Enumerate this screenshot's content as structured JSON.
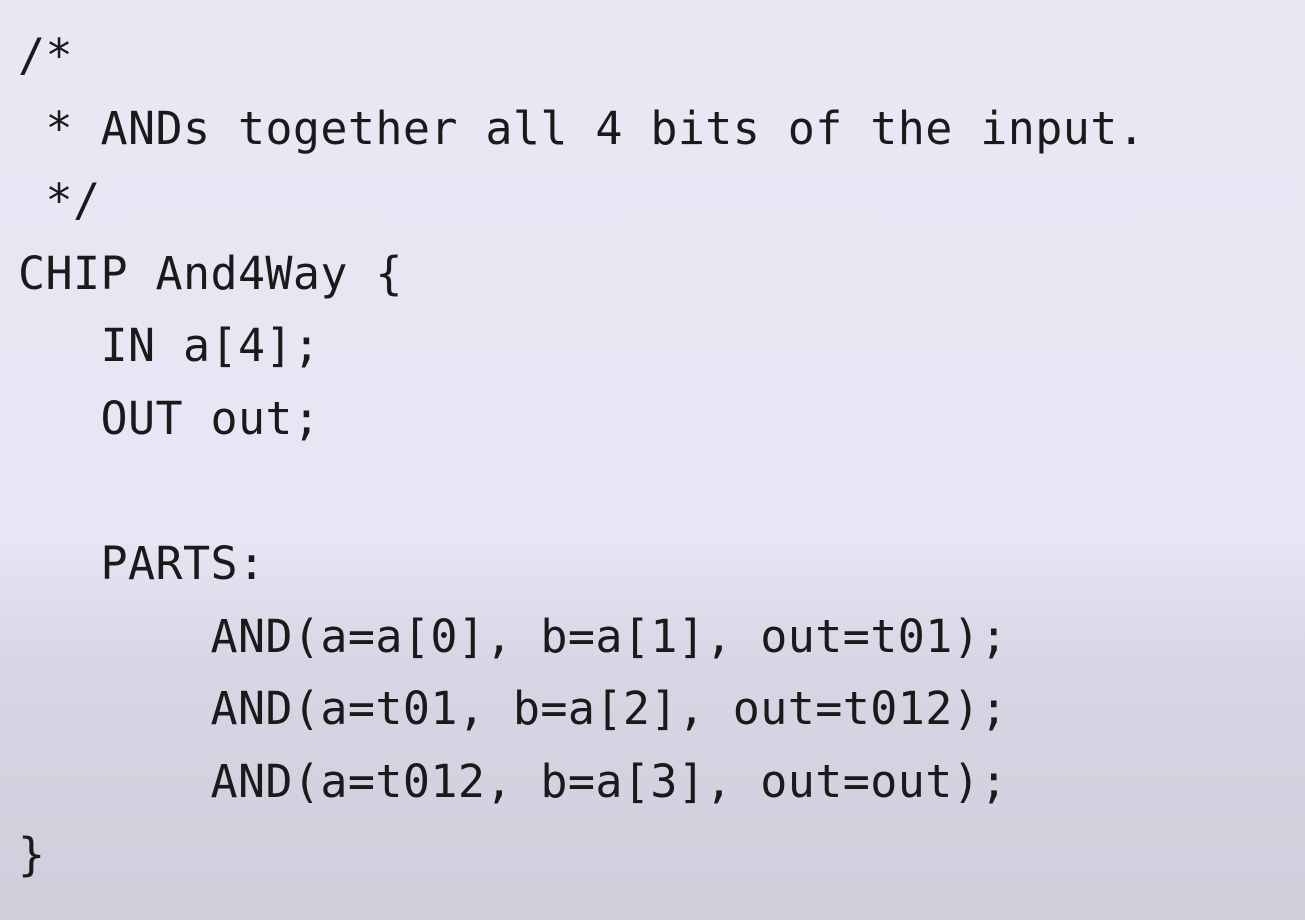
{
  "code": {
    "lines": [
      "/*",
      " * ANDs together all 4 bits of the input.",
      " */",
      "CHIP And4Way {",
      "   IN a[4];",
      "   OUT out;",
      "",
      "   PARTS:",
      "       AND(a=a[0], b=a[1], out=t01);",
      "       AND(a=t01, b=a[2], out=t012);",
      "       AND(a=t012, b=a[3], out=out);",
      "}"
    ]
  }
}
